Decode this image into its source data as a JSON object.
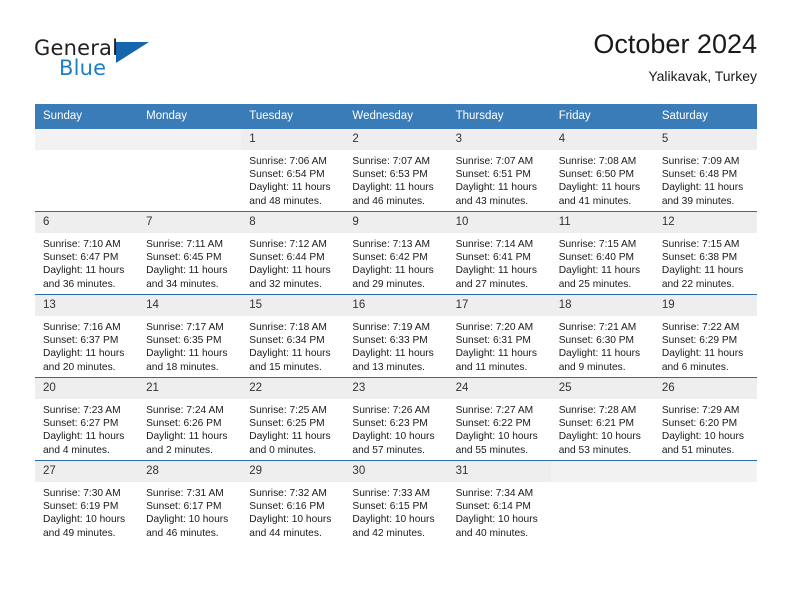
{
  "brand": {
    "name_top": "General",
    "name_bottom": "Blue",
    "accent_color": "#1566ad",
    "text_color": "#231f20"
  },
  "header": {
    "title": "October 2024",
    "subtitle": "Yalikavak, Turkey"
  },
  "theme": {
    "header_bg": "#3a7cb8",
    "row_divider": "#2b6ca8",
    "daynum_bg": "#eeeeee",
    "empty_daynum_bg": "#f2f2f2"
  },
  "weekday_headers": [
    "Sunday",
    "Monday",
    "Tuesday",
    "Wednesday",
    "Thursday",
    "Friday",
    "Saturday"
  ],
  "labels": {
    "sunrise_prefix": "Sunrise:",
    "sunset_prefix": "Sunset:",
    "daylight_prefix": "Daylight:"
  },
  "weeks": [
    [
      {
        "day": "",
        "line1": "",
        "line2": "",
        "line3": "",
        "line4": ""
      },
      {
        "day": "",
        "line1": "",
        "line2": "",
        "line3": "",
        "line4": ""
      },
      {
        "day": "1",
        "line1": "Sunrise: 7:06 AM",
        "line2": "Sunset: 6:54 PM",
        "line3": "Daylight: 11 hours",
        "line4": "and 48 minutes."
      },
      {
        "day": "2",
        "line1": "Sunrise: 7:07 AM",
        "line2": "Sunset: 6:53 PM",
        "line3": "Daylight: 11 hours",
        "line4": "and 46 minutes."
      },
      {
        "day": "3",
        "line1": "Sunrise: 7:07 AM",
        "line2": "Sunset: 6:51 PM",
        "line3": "Daylight: 11 hours",
        "line4": "and 43 minutes."
      },
      {
        "day": "4",
        "line1": "Sunrise: 7:08 AM",
        "line2": "Sunset: 6:50 PM",
        "line3": "Daylight: 11 hours",
        "line4": "and 41 minutes."
      },
      {
        "day": "5",
        "line1": "Sunrise: 7:09 AM",
        "line2": "Sunset: 6:48 PM",
        "line3": "Daylight: 11 hours",
        "line4": "and 39 minutes."
      }
    ],
    [
      {
        "day": "6",
        "line1": "Sunrise: 7:10 AM",
        "line2": "Sunset: 6:47 PM",
        "line3": "Daylight: 11 hours",
        "line4": "and 36 minutes."
      },
      {
        "day": "7",
        "line1": "Sunrise: 7:11 AM",
        "line2": "Sunset: 6:45 PM",
        "line3": "Daylight: 11 hours",
        "line4": "and 34 minutes."
      },
      {
        "day": "8",
        "line1": "Sunrise: 7:12 AM",
        "line2": "Sunset: 6:44 PM",
        "line3": "Daylight: 11 hours",
        "line4": "and 32 minutes."
      },
      {
        "day": "9",
        "line1": "Sunrise: 7:13 AM",
        "line2": "Sunset: 6:42 PM",
        "line3": "Daylight: 11 hours",
        "line4": "and 29 minutes."
      },
      {
        "day": "10",
        "line1": "Sunrise: 7:14 AM",
        "line2": "Sunset: 6:41 PM",
        "line3": "Daylight: 11 hours",
        "line4": "and 27 minutes."
      },
      {
        "day": "11",
        "line1": "Sunrise: 7:15 AM",
        "line2": "Sunset: 6:40 PM",
        "line3": "Daylight: 11 hours",
        "line4": "and 25 minutes."
      },
      {
        "day": "12",
        "line1": "Sunrise: 7:15 AM",
        "line2": "Sunset: 6:38 PM",
        "line3": "Daylight: 11 hours",
        "line4": "and 22 minutes."
      }
    ],
    [
      {
        "day": "13",
        "line1": "Sunrise: 7:16 AM",
        "line2": "Sunset: 6:37 PM",
        "line3": "Daylight: 11 hours",
        "line4": "and 20 minutes."
      },
      {
        "day": "14",
        "line1": "Sunrise: 7:17 AM",
        "line2": "Sunset: 6:35 PM",
        "line3": "Daylight: 11 hours",
        "line4": "and 18 minutes."
      },
      {
        "day": "15",
        "line1": "Sunrise: 7:18 AM",
        "line2": "Sunset: 6:34 PM",
        "line3": "Daylight: 11 hours",
        "line4": "and 15 minutes."
      },
      {
        "day": "16",
        "line1": "Sunrise: 7:19 AM",
        "line2": "Sunset: 6:33 PM",
        "line3": "Daylight: 11 hours",
        "line4": "and 13 minutes."
      },
      {
        "day": "17",
        "line1": "Sunrise: 7:20 AM",
        "line2": "Sunset: 6:31 PM",
        "line3": "Daylight: 11 hours",
        "line4": "and 11 minutes."
      },
      {
        "day": "18",
        "line1": "Sunrise: 7:21 AM",
        "line2": "Sunset: 6:30 PM",
        "line3": "Daylight: 11 hours",
        "line4": "and 9 minutes."
      },
      {
        "day": "19",
        "line1": "Sunrise: 7:22 AM",
        "line2": "Sunset: 6:29 PM",
        "line3": "Daylight: 11 hours",
        "line4": "and 6 minutes."
      }
    ],
    [
      {
        "day": "20",
        "line1": "Sunrise: 7:23 AM",
        "line2": "Sunset: 6:27 PM",
        "line3": "Daylight: 11 hours",
        "line4": "and 4 minutes."
      },
      {
        "day": "21",
        "line1": "Sunrise: 7:24 AM",
        "line2": "Sunset: 6:26 PM",
        "line3": "Daylight: 11 hours",
        "line4": "and 2 minutes."
      },
      {
        "day": "22",
        "line1": "Sunrise: 7:25 AM",
        "line2": "Sunset: 6:25 PM",
        "line3": "Daylight: 11 hours",
        "line4": "and 0 minutes."
      },
      {
        "day": "23",
        "line1": "Sunrise: 7:26 AM",
        "line2": "Sunset: 6:23 PM",
        "line3": "Daylight: 10 hours",
        "line4": "and 57 minutes."
      },
      {
        "day": "24",
        "line1": "Sunrise: 7:27 AM",
        "line2": "Sunset: 6:22 PM",
        "line3": "Daylight: 10 hours",
        "line4": "and 55 minutes."
      },
      {
        "day": "25",
        "line1": "Sunrise: 7:28 AM",
        "line2": "Sunset: 6:21 PM",
        "line3": "Daylight: 10 hours",
        "line4": "and 53 minutes."
      },
      {
        "day": "26",
        "line1": "Sunrise: 7:29 AM",
        "line2": "Sunset: 6:20 PM",
        "line3": "Daylight: 10 hours",
        "line4": "and 51 minutes."
      }
    ],
    [
      {
        "day": "27",
        "line1": "Sunrise: 7:30 AM",
        "line2": "Sunset: 6:19 PM",
        "line3": "Daylight: 10 hours",
        "line4": "and 49 minutes."
      },
      {
        "day": "28",
        "line1": "Sunrise: 7:31 AM",
        "line2": "Sunset: 6:17 PM",
        "line3": "Daylight: 10 hours",
        "line4": "and 46 minutes."
      },
      {
        "day": "29",
        "line1": "Sunrise: 7:32 AM",
        "line2": "Sunset: 6:16 PM",
        "line3": "Daylight: 10 hours",
        "line4": "and 44 minutes."
      },
      {
        "day": "30",
        "line1": "Sunrise: 7:33 AM",
        "line2": "Sunset: 6:15 PM",
        "line3": "Daylight: 10 hours",
        "line4": "and 42 minutes."
      },
      {
        "day": "31",
        "line1": "Sunrise: 7:34 AM",
        "line2": "Sunset: 6:14 PM",
        "line3": "Daylight: 10 hours",
        "line4": "and 40 minutes."
      },
      {
        "day": "",
        "line1": "",
        "line2": "",
        "line3": "",
        "line4": ""
      },
      {
        "day": "",
        "line1": "",
        "line2": "",
        "line3": "",
        "line4": ""
      }
    ]
  ]
}
